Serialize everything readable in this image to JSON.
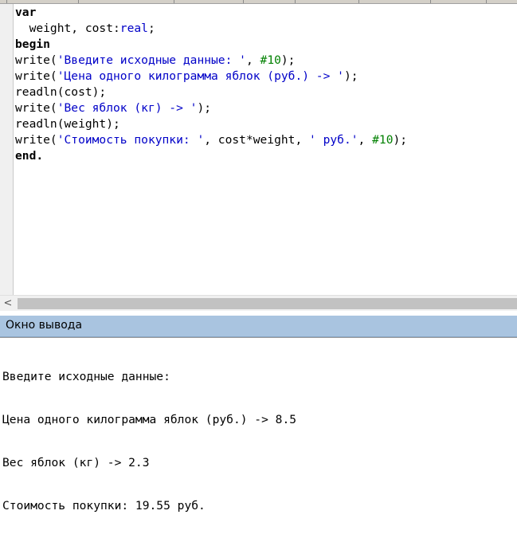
{
  "editor": {
    "lines": [
      [
        {
          "t": "var",
          "c": "kw"
        }
      ],
      [
        {
          "t": "  weight, cost:",
          "c": ""
        },
        {
          "t": "real",
          "c": "type"
        },
        {
          "t": ";",
          "c": ""
        }
      ],
      [
        {
          "t": "begin",
          "c": "kw"
        }
      ],
      [
        {
          "t": "write(",
          "c": ""
        },
        {
          "t": "'Введите исходные данные: '",
          "c": "str"
        },
        {
          "t": ", ",
          "c": ""
        },
        {
          "t": "#10",
          "c": "num"
        },
        {
          "t": ");",
          "c": ""
        }
      ],
      [
        {
          "t": "write(",
          "c": ""
        },
        {
          "t": "'Цена одного килограмма яблок (руб.) -> '",
          "c": "str"
        },
        {
          "t": ");",
          "c": ""
        }
      ],
      [
        {
          "t": "readln(cost);",
          "c": ""
        }
      ],
      [
        {
          "t": "write(",
          "c": ""
        },
        {
          "t": "'Вес яблок (кг) -> '",
          "c": "str"
        },
        {
          "t": ");",
          "c": ""
        }
      ],
      [
        {
          "t": "readln(weight);",
          "c": ""
        }
      ],
      [
        {
          "t": "write(",
          "c": ""
        },
        {
          "t": "'Стоимость покупки: '",
          "c": "str"
        },
        {
          "t": ", cost*weight, ",
          "c": ""
        },
        {
          "t": "' руб.'",
          "c": "str"
        },
        {
          "t": ", ",
          "c": ""
        },
        {
          "t": "#10",
          "c": "num"
        },
        {
          "t": ");",
          "c": ""
        }
      ],
      [
        {
          "t": "end.",
          "c": "kw"
        }
      ]
    ]
  },
  "scrollbar": {
    "left_arrow": "<"
  },
  "output": {
    "title": "Окно вывода",
    "lines": [
      "Введите исходные данные:",
      "Цена одного килограмма яблок (руб.) -> 8.5",
      "Вес яблок (кг) -> 2.3",
      "Стоимость покупки: 19.55 руб."
    ]
  },
  "colors": {
    "keyword": "#000000",
    "string": "#0000c8",
    "number": "#008000",
    "output_header": "#a9c4e0"
  }
}
